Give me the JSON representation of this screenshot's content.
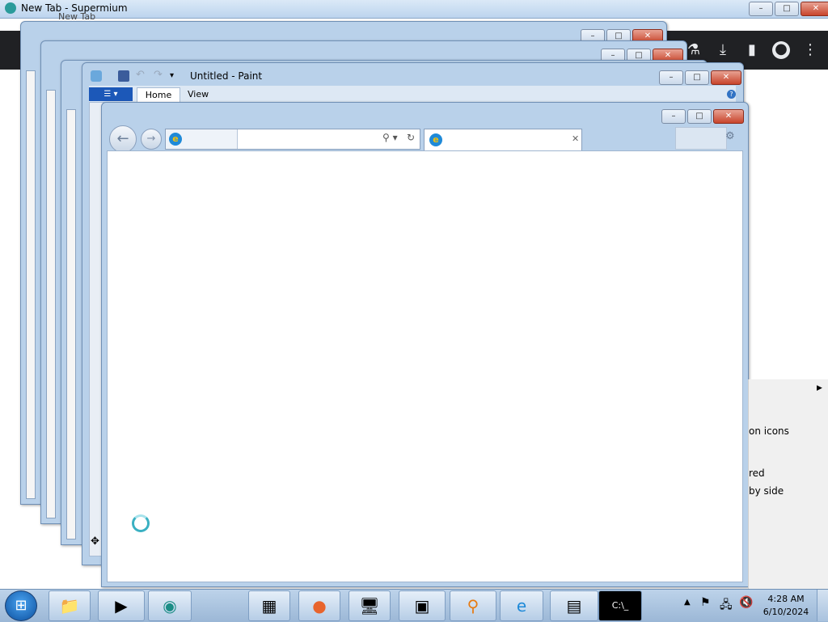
{
  "supermium": {
    "window_title": "New Tab - Supermium",
    "tab_label": "New Tab",
    "toolbar_icons": [
      "labs-icon",
      "download-icon",
      "side-panel-icon",
      "profile-icon",
      "menu-icon"
    ]
  },
  "paint": {
    "window_title": "Untitled - Paint",
    "tabs": [
      "Home",
      "View"
    ]
  },
  "context_menu": {
    "items": [
      "on icons",
      "red",
      "by side"
    ]
  },
  "caption": {
    "minimize": "–",
    "maximize": "□",
    "close": "✕"
  },
  "taskbar": {
    "time": "4:28 AM",
    "date": "6/10/2024",
    "pinned_icons": [
      "file-explorer-icon",
      "media-player-icon",
      "supermium-icon",
      "calculator-icon",
      "firefox-icon",
      "remote-desktop-icon",
      "disk-icon",
      "search-icon",
      "internet-explorer-icon",
      "task-manager-icon",
      "command-prompt-icon"
    ]
  },
  "colors": {
    "aero_frame": "#b9d1ea",
    "taskbar": "#9bb7d6",
    "close_button": "#c8442b",
    "chrome_toolbar": "#202124"
  }
}
